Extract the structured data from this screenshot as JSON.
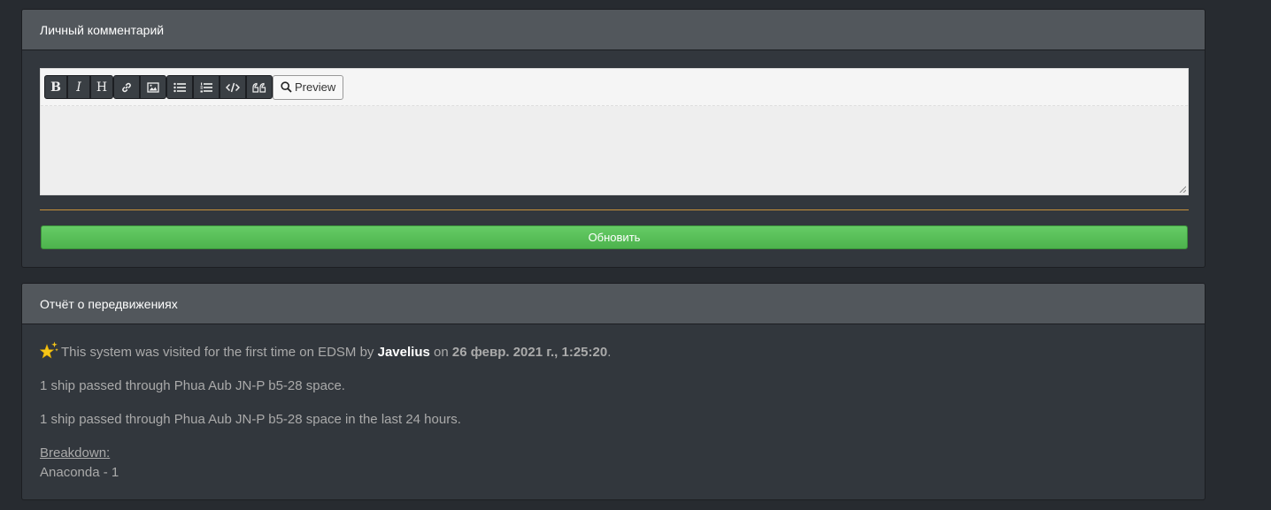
{
  "comment_card": {
    "title": "Личный комментарий",
    "toolbar": {
      "bold": "B",
      "italic": "I",
      "heading": "H",
      "link_icon": "link-icon",
      "image_icon": "image-icon",
      "ul_icon": "unordered-list-icon",
      "ol_icon": "ordered-list-icon",
      "code_icon": "code-icon",
      "quote_icon": "quote-icon",
      "preview_label": "Preview"
    },
    "textarea_value": "",
    "update_label": "Обновить"
  },
  "report_card": {
    "title": "Отчёт о передвижениях",
    "first_visit": {
      "prefix": "This system was visited for the first time on EDSM by",
      "commander": "Javelius",
      "middle": "on",
      "date": "26 февр. 2021 г., 1:25:20",
      "suffix": "."
    },
    "line_total": "1 ship passed through Phua Aub JN-P b5-28 space.",
    "line_24h": "1 ship passed through Phua Aub JN-P b5-28 space in the last 24 hours.",
    "breakdown_title": "Breakdown:",
    "breakdown_items": [
      "Anaconda - 1"
    ]
  },
  "colors": {
    "background": "#272b30",
    "card": "#32373d",
    "card_header": "#52575c",
    "accent_divider": "#c8913a",
    "success": "#5cb85c"
  }
}
